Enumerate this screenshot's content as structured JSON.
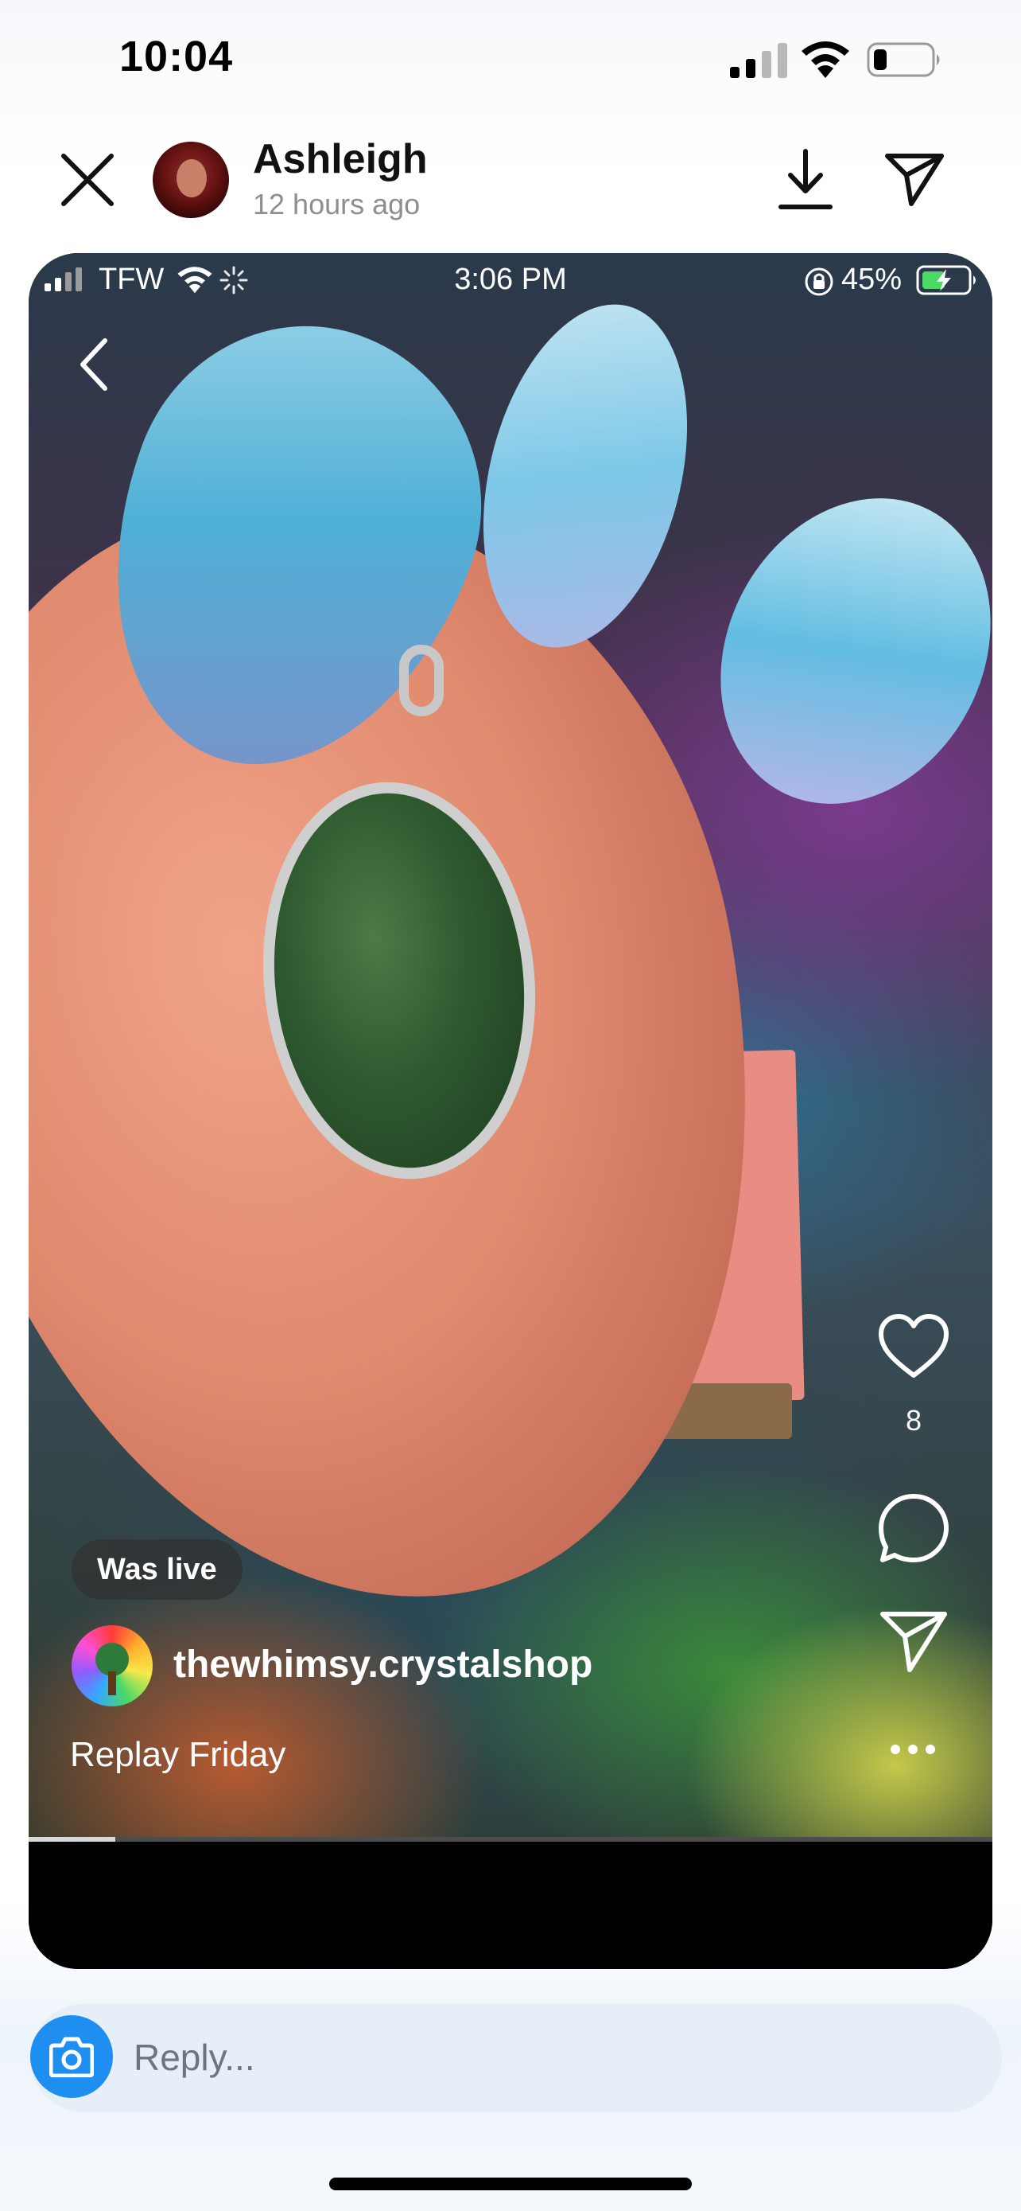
{
  "status_bar": {
    "time": "10:04",
    "icons": [
      "cellular-signal-icon",
      "wifi-icon",
      "battery-icon"
    ]
  },
  "header": {
    "user_name": "Ashleigh",
    "posted_ago": "12 hours ago",
    "icons": [
      "close-icon",
      "download-icon",
      "send-icon"
    ]
  },
  "story": {
    "embedded_status_bar": {
      "carrier": "TFW",
      "time": "3:06 PM",
      "battery": "45%"
    },
    "was_live_badge": "Was live",
    "creator_username": "thewhimsy.crystalshop",
    "caption": "Replay Friday",
    "like_count": "8",
    "progress": 0.09,
    "icons": [
      "back-chevron-icon",
      "heart-icon",
      "comment-icon",
      "send-icon",
      "more-icon"
    ]
  },
  "reply_bar": {
    "placeholder": "Reply...",
    "icon": "camera-icon"
  },
  "colors": {
    "accent_blue": "#1f8ef1",
    "reply_bar_bg": "#e6eef8",
    "secondary_text": "#8e8e8e"
  }
}
